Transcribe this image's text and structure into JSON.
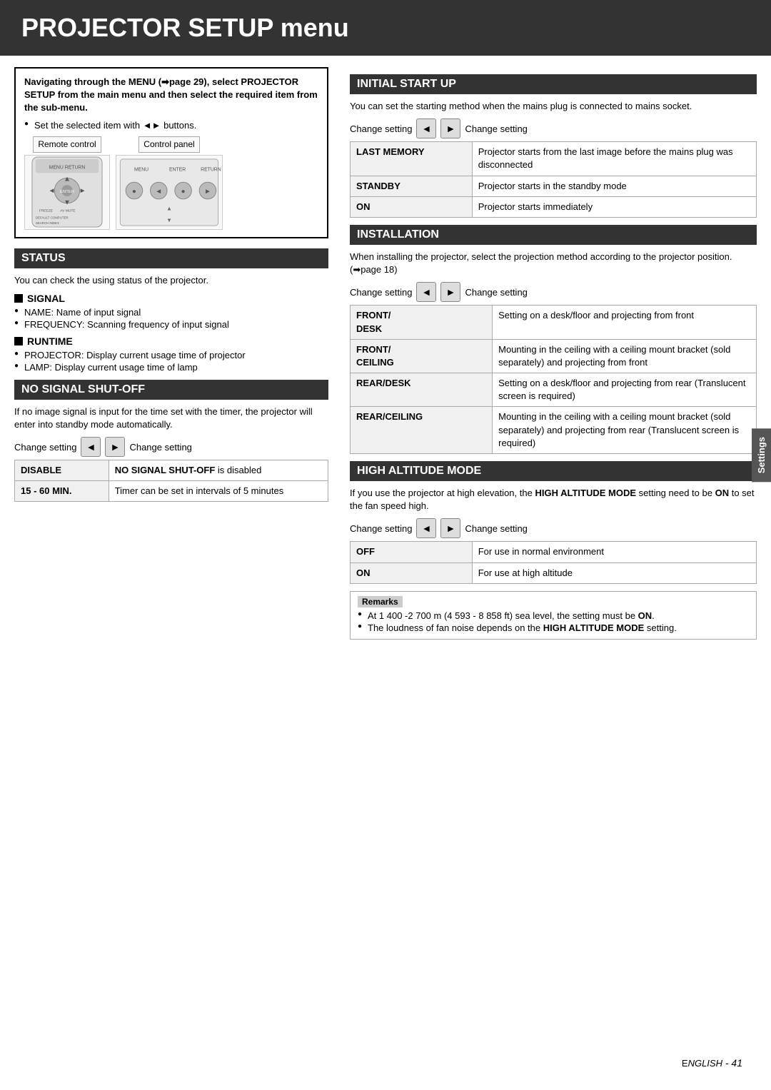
{
  "page": {
    "title": "PROJECTOR SETUP menu",
    "footer": "ENGLISH - 41"
  },
  "intro": {
    "text1": "Navigating through the MENU (➡page 29), select PROJECTOR SETUP from the main menu and then select the required item from the sub-menu.",
    "bullet1": "Set the selected item with ◄► buttons.",
    "label_remote": "Remote control",
    "label_panel": "Control panel"
  },
  "status": {
    "header": "STATUS",
    "text": "You can check the using status of the projector.",
    "signal_header": "SIGNAL",
    "signal_bullet1": "NAME: Name of input signal",
    "signal_bullet2": "FREQUENCY: Scanning frequency of input signal",
    "runtime_header": "RUNTIME",
    "runtime_bullet1": "PROJECTOR: Display current usage time of projector",
    "runtime_bullet2": "LAMP: Display current usage time of lamp"
  },
  "no_signal": {
    "header": "NO SIGNAL SHUT-OFF",
    "text": "If no image signal is input for the time set with the timer, the projector will enter into standby mode automatically.",
    "change_setting_left": "Change setting",
    "change_setting_right": "Change setting",
    "table": [
      {
        "key": "DISABLE",
        "value": "NO SIGNAL SHUT-OFF is disabled"
      },
      {
        "key": "15 - 60 MIN.",
        "value": "Timer can be set in intervals of 5 minutes"
      }
    ]
  },
  "initial_start_up": {
    "header": "INITIAL START UP",
    "text": "You can set the starting method when the mains plug is connected to mains socket.",
    "change_setting_left": "Change setting",
    "change_setting_right": "Change setting",
    "table": [
      {
        "key": "LAST MEMORY",
        "value": "Projector starts from the last image before the mains plug was disconnected"
      },
      {
        "key": "STANDBY",
        "value": "Projector starts in the standby mode"
      },
      {
        "key": "ON",
        "value": "Projector starts immediately"
      }
    ]
  },
  "installation": {
    "header": "INSTALLATION",
    "text": "When installing the projector, select the projection method according to the projector position.",
    "page_ref": "(➡page 18)",
    "change_setting_left": "Change setting",
    "change_setting_right": "Change setting",
    "table": [
      {
        "key": "FRONT/ DESK",
        "value": "Setting on a desk/floor and projecting from front"
      },
      {
        "key": "FRONT/ CEILING",
        "value": "Mounting in the ceiling with a ceiling mount bracket (sold separately) and projecting from front"
      },
      {
        "key": "REAR/DESK",
        "value": "Setting on a desk/floor and projecting from rear (Translucent screen is required)"
      },
      {
        "key": "REAR/CEILING",
        "value": "Mounting in the ceiling with a ceiling mount bracket (sold separately) and projecting from rear (Translucent screen is required)"
      }
    ]
  },
  "high_altitude": {
    "header": "HIGH ALTITUDE MODE",
    "text1": "If you use the projector at high elevation, the ",
    "text2": "HIGH ALTITUDE MODE",
    "text3": " setting need to be ",
    "text4": "ON",
    "text5": " to set the fan speed high.",
    "change_setting_left": "Change setting",
    "change_setting_right": "Change setting",
    "table": [
      {
        "key": "OFF",
        "value": "For use in normal environment"
      },
      {
        "key": "ON",
        "value": "For use at high altitude"
      }
    ],
    "remarks_header": "Remarks",
    "remarks": [
      "At 1 400 -2 700 m (4 593 - 8 858 ft) sea level, the setting must be ON.",
      "The loudness of fan noise depends on the HIGH ALTITUDE MODE setting."
    ]
  },
  "settings_tab": "Settings"
}
